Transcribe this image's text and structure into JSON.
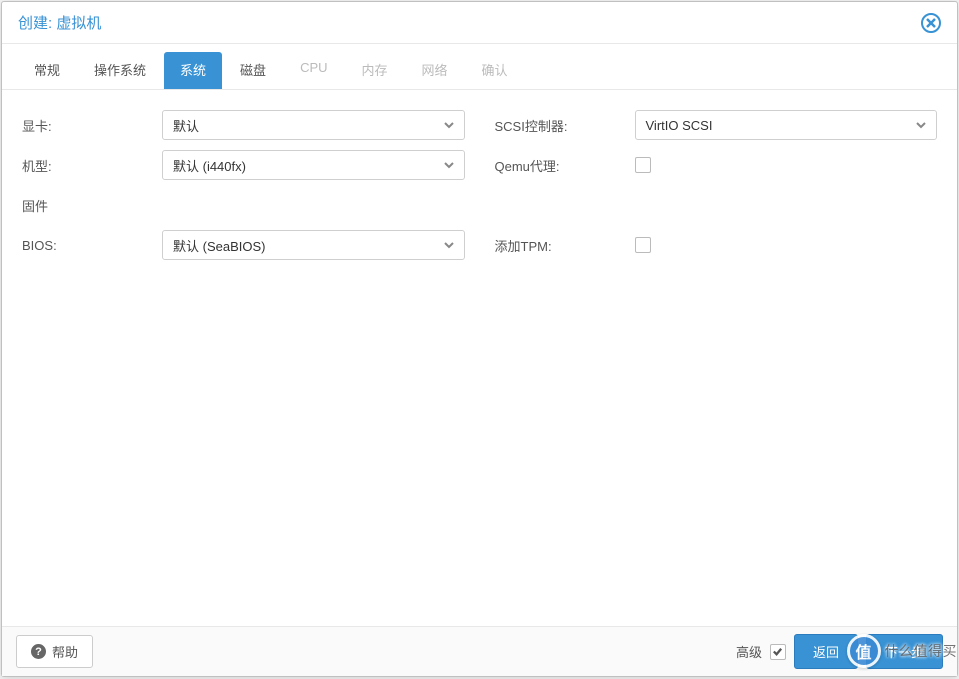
{
  "dialog": {
    "title": "创建: 虚拟机"
  },
  "tabs": [
    {
      "label": "常规",
      "state": "normal"
    },
    {
      "label": "操作系统",
      "state": "normal"
    },
    {
      "label": "系统",
      "state": "active"
    },
    {
      "label": "磁盘",
      "state": "normal"
    },
    {
      "label": "CPU",
      "state": "disabled"
    },
    {
      "label": "内存",
      "state": "disabled"
    },
    {
      "label": "网络",
      "state": "disabled"
    },
    {
      "label": "确认",
      "state": "disabled"
    }
  ],
  "form": {
    "left": {
      "graphics_label": "显卡:",
      "graphics_value": "默认",
      "machine_label": "机型:",
      "machine_value": "默认 (i440fx)",
      "firmware_label": "固件",
      "bios_label": "BIOS:",
      "bios_value": "默认 (SeaBIOS)"
    },
    "right": {
      "scsi_label": "SCSI控制器:",
      "scsi_value": "VirtIO SCSI",
      "qemu_label": "Qemu代理:",
      "qemu_checked": false,
      "tpm_label": "添加TPM:",
      "tpm_checked": false
    }
  },
  "footer": {
    "help_label": "帮助",
    "advanced_label": "高级",
    "advanced_checked": true,
    "back_label": "返回",
    "next_label": "下一步"
  },
  "watermark": {
    "badge": "值",
    "text": "什么值得买"
  }
}
